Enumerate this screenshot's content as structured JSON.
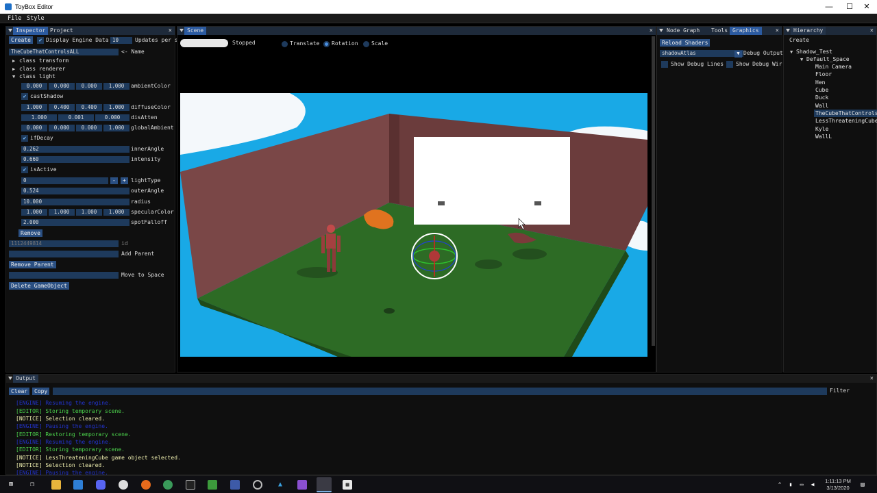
{
  "window": {
    "title": "ToyBox Editor",
    "controls": {
      "minimize": "—",
      "maximize": "☐",
      "close": "✕"
    }
  },
  "menu": {
    "file": "File",
    "style": "Style"
  },
  "inspector": {
    "tabs": [
      "Inspector",
      "Project"
    ],
    "create": "Create",
    "display_engine_data": "Display Engine Data",
    "updates_value": "10",
    "updates_label": "Updates per s",
    "name_value": "TheCubeThatControlsALL",
    "name_label": "<- Name",
    "class_transform": "class transform",
    "class_renderer": "class renderer",
    "class_light": "class light",
    "ambient": {
      "values": [
        "0.000",
        "0.000",
        "0.000",
        "1.000"
      ],
      "label": "ambientColor"
    },
    "cast_shadow": "castShadow",
    "diffuse": {
      "values": [
        "1.000",
        "0.400",
        "0.400",
        "1.000"
      ],
      "label": "diffuseColor"
    },
    "dis_atten": {
      "values": [
        "1.000",
        "0.001",
        "0.000"
      ],
      "label": "disAtten"
    },
    "global_ambient": {
      "values": [
        "0.000",
        "0.000",
        "0.000",
        "1.000"
      ],
      "label": "globalAmbient"
    },
    "if_decay": "ifDecay",
    "inner_angle": {
      "value": "0.262",
      "label": "innerAngle"
    },
    "intensity": {
      "value": "0.660",
      "label": "intensity"
    },
    "is_active": "isActive",
    "light_type": {
      "value": "0",
      "minus": "-",
      "plus": "+",
      "label": "lightType"
    },
    "outer_angle": {
      "value": "0.524",
      "label": "outerAngle"
    },
    "radius": {
      "value": "10.000",
      "label": "radius"
    },
    "specular": {
      "values": [
        "1.000",
        "1.000",
        "1.000",
        "1.000"
      ],
      "label": "specularColor"
    },
    "spot_falloff": {
      "value": "2.000",
      "label": "spotFalloff"
    },
    "remove": "Remove",
    "id_value": "1112449814",
    "id_label": "id",
    "add_parent": "Add Parent",
    "remove_parent": "Remove Parent",
    "move_to_space": "Move to Space",
    "delete_gameobject": "Delete GameObject"
  },
  "scene": {
    "tab": "Scene",
    "state": "Stopped",
    "modes": [
      "Translate",
      "Rotation",
      "Scale"
    ],
    "active_mode": "Rotation"
  },
  "nodegraph": {
    "tabs": [
      "Node Graph",
      "Tools",
      "Graphics"
    ],
    "reload_shaders": "Reload Shaders",
    "atlas": "shadowAtlas",
    "debug_output": "Debug Output",
    "show_debug_lines": "Show Debug Lines",
    "show_debug_wire": "Show Debug Wir"
  },
  "hierarchy": {
    "tab": "Hierarchy",
    "create": "Create",
    "root": "Shadow_Test",
    "space": "Default_Space",
    "items": [
      "Main Camera",
      "Floor",
      "Hen",
      "Cube",
      "Duck",
      "Wall",
      "TheCubeThatControls",
      "LessThreateningCube",
      "Kyle",
      "WallL"
    ],
    "selected": "TheCubeThatControls"
  },
  "output": {
    "tab": "Output",
    "clear": "Clear",
    "copy": "Copy",
    "filter": "Filter",
    "lines": [
      {
        "text": "[ENGINE] Resuming the engine.",
        "color": "#2233cc"
      },
      {
        "text": "[EDITOR] Storing temporary scene.",
        "color": "#4cd44c"
      },
      {
        "text": "[NOTICE] Selection cleared.",
        "color": "#f0f0b0"
      },
      {
        "text": "[ENGINE] Pausing the engine.",
        "color": "#2233cc"
      },
      {
        "text": "[EDITOR] Restoring temporary scene.",
        "color": "#4cd44c"
      },
      {
        "text": "[ENGINE] Resuming the engine.",
        "color": "#2233cc"
      },
      {
        "text": "[EDITOR] Storing temporary scene.",
        "color": "#4cd44c"
      },
      {
        "text": "[NOTICE] LessThreateningCube game object selected.",
        "color": "#f0f0b0"
      },
      {
        "text": "[NOTICE] Selection cleared.",
        "color": "#f0f0b0"
      },
      {
        "text": "[ENGINE] Pausing the engine.",
        "color": "#2233cc"
      }
    ]
  },
  "taskbar": {
    "time": "1:11:13 PM",
    "date": "3/13/2020"
  },
  "colors": {
    "accent": "#2b5aa0",
    "field": "#1e3a5c",
    "sky": "#19a9e6",
    "floor": "#2d6b25",
    "wall": "#6b3c3c"
  }
}
